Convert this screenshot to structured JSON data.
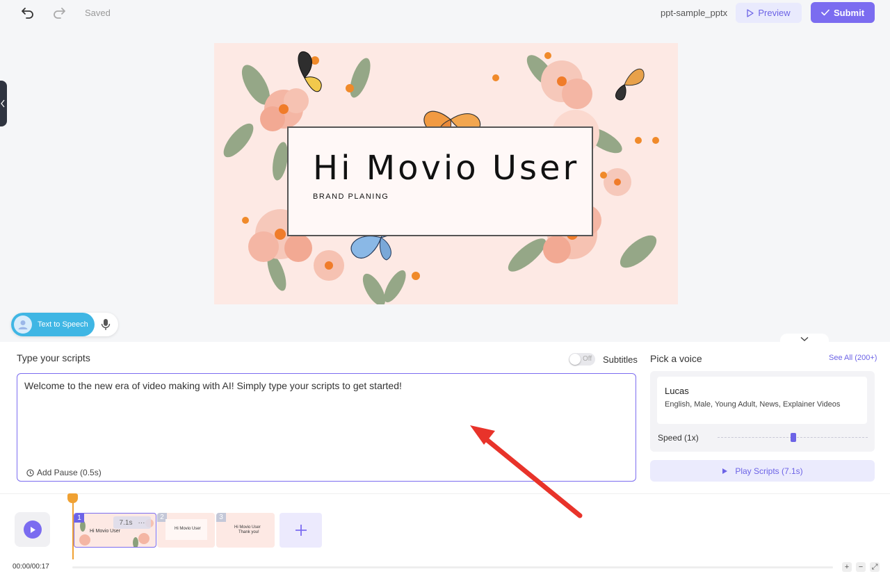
{
  "topbar": {
    "saved_label": "Saved",
    "file_name": "ppt-sample_pptx",
    "preview_label": "Preview",
    "submit_label": "Submit"
  },
  "slide": {
    "title": "Hi Movio User",
    "subtitle": "BRAND PLANING"
  },
  "mode": {
    "tts_label": "Text to Speech"
  },
  "script": {
    "label": "Type your scripts",
    "subtitles_label": "Subtitles",
    "toggle_state": "Off",
    "text": "Welcome to the new era of video making with AI! Simply type your scripts to get started!",
    "add_pause_label": "Add Pause (0.5s)"
  },
  "voice": {
    "label": "Pick a voice",
    "see_all": "See All (200+)",
    "name": "Lucas",
    "description": "English, Male, Young Adult, News, Explainer Videos",
    "speed_label": "Speed (1x)",
    "play_label": "Play Scripts (7.1s)"
  },
  "timeline": {
    "time": "00:00/00:17",
    "clips": [
      {
        "num": "1",
        "duration": "7.1s",
        "mini": "Hi Movio User"
      },
      {
        "num": "2",
        "mini": "Hi Movio User"
      },
      {
        "num": "3",
        "mini": "Hi Movio User",
        "mini2": "Thank you!"
      }
    ]
  },
  "colors": {
    "accent": "#7b6cf0",
    "slide_bg": "#fde9e4",
    "playhead": "#f0a132",
    "tts": "#3fb6e4"
  }
}
